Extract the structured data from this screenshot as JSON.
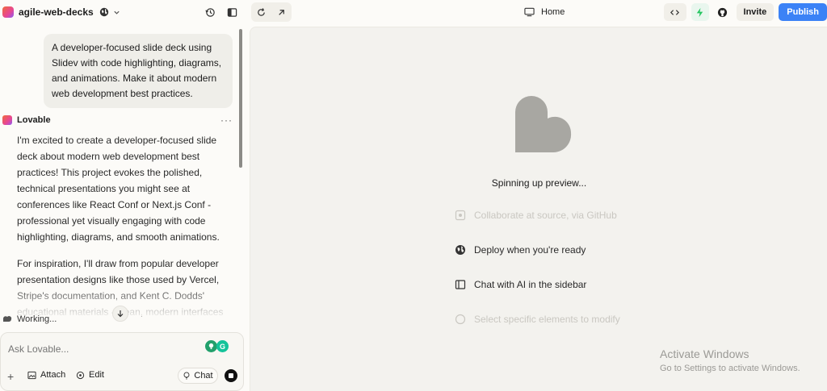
{
  "header": {
    "project_name": "agile-web-decks",
    "page_label": "Home",
    "invite_label": "Invite",
    "publish_label": "Publish"
  },
  "chat": {
    "user_message": "A developer-focused slide deck using Slidev with code highlighting, diagrams, and animations. Make it about modern web development best practices.",
    "assistant_name": "Lovable",
    "more_label": "···",
    "assistant_paragraphs": [
      "I'm excited to create a developer-focused slide deck about modern web development best practices! This project evokes the polished, technical presentations you might see at conferences like React Conf or Next.js Conf - professional yet visually engaging with code highlighting, diagrams, and smooth animations.",
      "For inspiration, I'll draw from popular developer presentation designs like those used by Vercel, Stripe's documentation, and Kent C. Dodds' educational materials - clean, modern interfaces"
    ],
    "status": "Working..."
  },
  "composer": {
    "placeholder": "Ask Lovable...",
    "plus": "+",
    "attach_label": "Attach",
    "edit_label": "Edit",
    "chat_label": "Chat",
    "badge_letter": "G"
  },
  "preview": {
    "status": "Spinning up preview...",
    "features": [
      "Collaborate at source, via GitHub",
      "Deploy when you're ready",
      "Chat with AI in the sidebar",
      "Select specific elements to modify"
    ]
  },
  "watermark": {
    "title": "Activate Windows",
    "subtitle": "Go to Settings to activate Windows."
  },
  "colors": {
    "publish": "#3b82f6",
    "bolt": "#22c55e",
    "heart": "#a8a7a2"
  },
  "icons": [
    "globe-icon",
    "chevron-down-icon",
    "history-icon",
    "sidebar-toggle-icon",
    "refresh-icon",
    "external-link-icon",
    "monitor-icon",
    "code-icon",
    "bolt-icon",
    "github-icon"
  ]
}
